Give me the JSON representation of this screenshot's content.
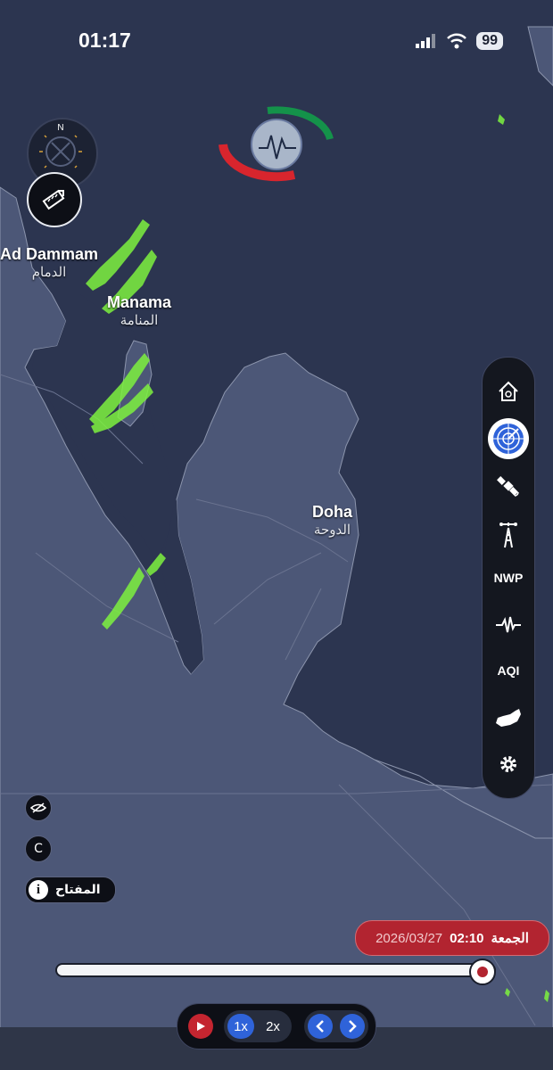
{
  "status_bar": {
    "time": "01:17",
    "battery": "99",
    "signal_icon": "signal-bars-icon",
    "wifi_icon": "wifi-icon"
  },
  "map": {
    "cities": [
      {
        "name_en": "Ad Dammam",
        "name_ar": "الدمام"
      },
      {
        "name_en": "Manama",
        "name_ar": "المنامة"
      },
      {
        "name_en": "Doha",
        "name_ar": "الدوحة"
      }
    ],
    "colors": {
      "water": "#2c3550",
      "land": "#4c5777",
      "radar": "#7ef23f"
    }
  },
  "compass": {
    "north_label": "N"
  },
  "toolbar": {
    "items": [
      {
        "icon": "home-icon"
      },
      {
        "icon": "radar-icon",
        "active": true
      },
      {
        "icon": "satellite-icon"
      },
      {
        "icon": "weather-tower-icon"
      },
      {
        "label": "NWP"
      },
      {
        "icon": "seismic-wave-icon"
      },
      {
        "label": "AQI"
      },
      {
        "icon": "uae-map-icon"
      },
      {
        "icon": "gear-icon"
      }
    ]
  },
  "left_controls": {
    "legend_label": "المفتاح",
    "copyright_label": "C"
  },
  "timeline": {
    "day": "الجمعة",
    "time": "02:10",
    "date": "2026/03/27",
    "progress": 0.97
  },
  "playback": {
    "speed_1": "1x",
    "speed_2": "2x",
    "active_speed": "1x"
  },
  "accent_colors": {
    "red": "#b22430",
    "blue": "#2f63d9"
  }
}
